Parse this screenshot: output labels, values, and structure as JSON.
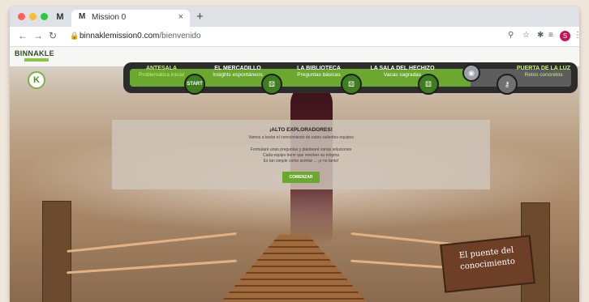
{
  "browser": {
    "pinned_tab_icon": "M",
    "tab": {
      "favicon": "M",
      "title": "Mission 0",
      "close": "×"
    },
    "new_tab": "+",
    "url_host": "binnaklemission0.com",
    "url_path": "/bienvenido",
    "profile_initial": "S"
  },
  "site": {
    "brand": "BINNAKLE",
    "logo_letter": "K"
  },
  "progress": {
    "stages": [
      {
        "title": "ANTESALA",
        "subtitle": "Problemática inicial"
      },
      {
        "title": "EL MERCADILLO",
        "subtitle": "Insights espontáneos"
      },
      {
        "title": "LA BIBLIOTECA",
        "subtitle": "Preguntas básicas"
      },
      {
        "title": "LA SALA DEL HECHIZO",
        "subtitle": "Vacas sagradas"
      },
      {
        "title": "PUERTA DE LA LUZ",
        "subtitle": "Retos concretos"
      }
    ],
    "start_label": "START"
  },
  "modal": {
    "title": "¡ALTO EXPLORADORES!",
    "subtitle": "Vamos a testar el conocimiento de estos valientes equipos",
    "lines": [
      "Formularé unas preguntas y plantearé varias soluciones",
      "Cada equipo tiene que resolver su enigma",
      "Es tan simple como acertar ... ¡o no tanto!"
    ],
    "button": "COMENZAR"
  },
  "scene": {
    "sign_line1": "El puente del",
    "sign_line2": "conocimiento"
  },
  "colors": {
    "accent_green": "#6aa830",
    "bar_dark": "#2c2c2c"
  }
}
